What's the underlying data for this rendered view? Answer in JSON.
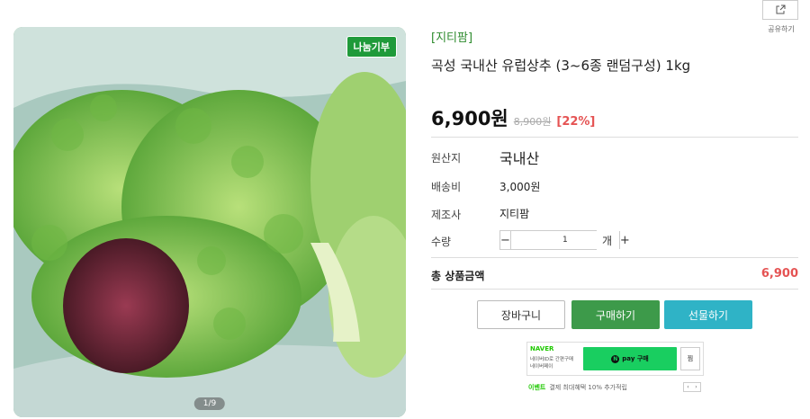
{
  "gallery": {
    "badge": "나눔기부",
    "counter": "1/9"
  },
  "share": {
    "label": "공유하기",
    "icon": "share-icon"
  },
  "product": {
    "seller": "[지티팜]",
    "title": "곡성 국내산 유럽상추 (3~6종 랜덤구성) 1kg",
    "price": "6,900원",
    "original_price": "8,900원",
    "discount": "[22%]"
  },
  "info": {
    "origin_label": "원산지",
    "origin_value": "국내산",
    "shipping_label": "배송비",
    "shipping_value": "3,000원",
    "maker_label": "제조사",
    "maker_value": "지티팜",
    "qty_label": "수량",
    "qty_value": "1",
    "qty_unit": "개",
    "qty_minus": "−",
    "qty_plus": "+"
  },
  "total": {
    "label": "총 상품금액",
    "value": "6,900"
  },
  "actions": {
    "cart": "장바구니",
    "buy": "구매하기",
    "gift": "선물하기"
  },
  "naver": {
    "brand": "NAVER",
    "desc1": "네이버ID로 간편구매",
    "desc2": "네이버페이",
    "npay_label": "pay 구매",
    "npay_n": "N",
    "zzim": "찜",
    "event_tag": "이벤트",
    "event_text": "결제 최대혜택 10% 추가적립",
    "nav_prev": "‹",
    "nav_next": "›"
  },
  "colors": {
    "accent_green": "#3d9a4a",
    "gift_teal": "#2fb3c6",
    "discount_red": "#e55353",
    "naver_green": "#19ce60"
  }
}
